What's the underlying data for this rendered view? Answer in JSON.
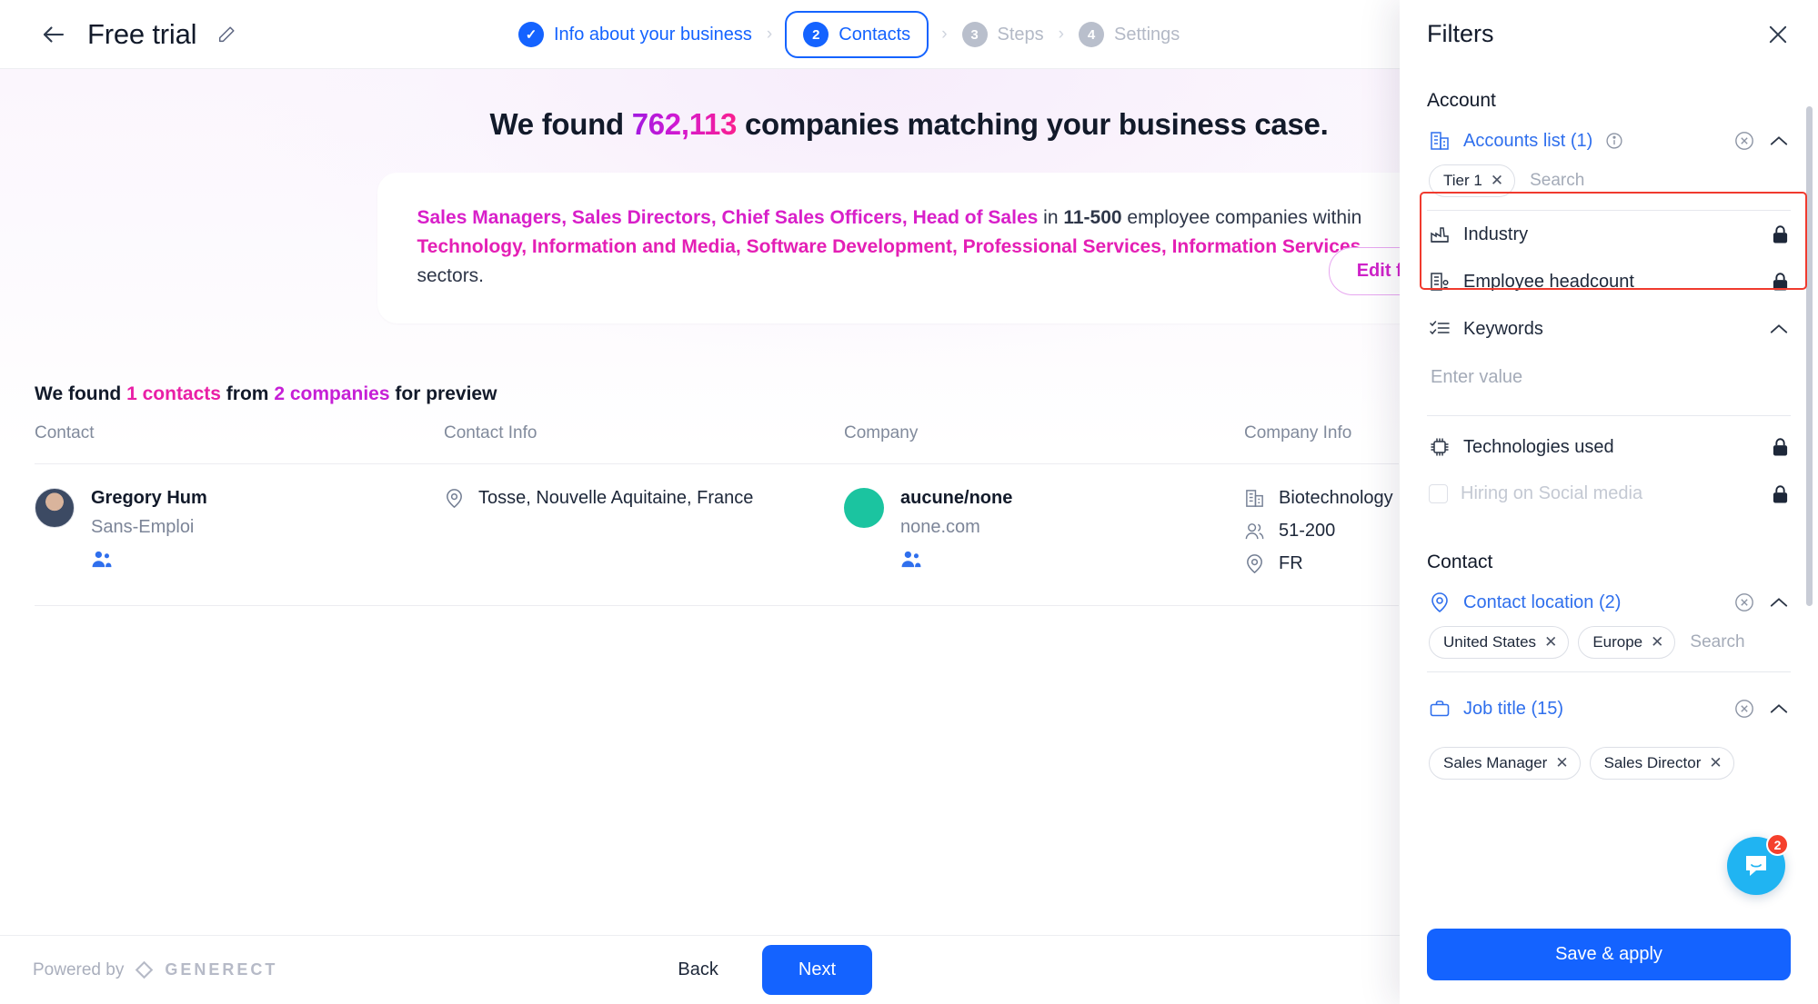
{
  "topbar": {
    "back_icon": "arrow-left-icon",
    "title": "Free trial",
    "edit_icon": "pencil-icon",
    "steps": [
      {
        "badge": "✓",
        "label": "Info about your business",
        "state": "done"
      },
      {
        "badge": "2",
        "label": "Contacts",
        "state": "active"
      },
      {
        "badge": "3",
        "label": "Steps",
        "state": "todo"
      },
      {
        "badge": "4",
        "label": "Settings",
        "state": "todo"
      }
    ],
    "separator": "›"
  },
  "main": {
    "headline_prefix": "We found ",
    "headline_count": "762,113",
    "headline_suffix": " companies matching your business case.",
    "summary": {
      "titles": "Sales Managers, Sales Directors, Chief Sales Officers, Head of Sales",
      "in_word": " in ",
      "headcount": "11-500",
      "employee_text": " employee companies within ",
      "industries": "Technology, Information and Media, Software Development, Professional Services, Information Services",
      "sectors_text": " sectors."
    },
    "edit_filters_label": "Edit filters",
    "preview": {
      "prefix": "We found ",
      "contacts": "1 contacts",
      "middle": " from ",
      "companies": "2 companies",
      "suffix": " for preview",
      "columns": [
        "Contact",
        "Contact Info",
        "Company",
        "Company Info"
      ],
      "rows": [
        {
          "contact_name": "Gregory Hum",
          "contact_role": "Sans-Emploi",
          "contact_social_icon": "linkedin-people-icon",
          "contact_location": "Tosse, Nouvelle Aquitaine, France",
          "contact_location_icon": "map-pin-icon",
          "company_name": "aucune/none",
          "company_domain": "none.com",
          "company_social_icon": "linkedin-people-icon",
          "company_industry": "Biotechnology",
          "company_industry_icon": "building-icon",
          "company_headcount": "51-200",
          "company_headcount_icon": "people-icon",
          "company_country": "FR",
          "company_country_icon": "map-pin-icon"
        }
      ]
    }
  },
  "footer": {
    "powered_by": "Powered by",
    "brand": "GENERECT",
    "brand_icon": "diamond-logo-icon",
    "back_label": "Back",
    "next_label": "Next"
  },
  "filters": {
    "title": "Filters",
    "close_icon": "close-icon",
    "account_section": "Account",
    "contact_section": "Contact",
    "save_apply_label": "Save & apply",
    "groups": [
      {
        "id": "accounts-list",
        "icon": "building-list-icon",
        "label": "Accounts list (1)",
        "state": "active",
        "has_info": true,
        "has_clear": true,
        "chevron": "chevron-up-icon",
        "chips": [
          "Tier 1"
        ],
        "search_placeholder": "Search"
      },
      {
        "id": "industry",
        "icon": "factory-icon",
        "label": "Industry",
        "state": "locked",
        "lock_icon": "lock-icon"
      },
      {
        "id": "employee-headcount",
        "icon": "building-person-icon",
        "label": "Employee headcount",
        "state": "locked",
        "lock_icon": "lock-icon"
      },
      {
        "id": "keywords",
        "icon": "checklist-icon",
        "label": "Keywords",
        "state": "open",
        "chevron": "chevron-up-icon",
        "value_placeholder": "Enter value"
      },
      {
        "id": "technologies-used",
        "icon": "chip-icon",
        "label": "Technologies used",
        "state": "locked",
        "lock_icon": "lock-icon"
      },
      {
        "id": "hiring-on-social-media",
        "icon": "checkbox-icon",
        "label": "Hiring on Social media",
        "state": "locked-disabled",
        "lock_icon": "lock-icon"
      },
      {
        "id": "contact-location",
        "icon": "map-pin-icon",
        "label": "Contact location (2)",
        "state": "active",
        "has_clear": true,
        "chevron": "chevron-up-icon",
        "chips": [
          "United States",
          "Europe"
        ],
        "search_placeholder": "Search"
      },
      {
        "id": "job-title",
        "icon": "briefcase-icon",
        "label": "Job title (15)",
        "state": "active",
        "has_clear": true,
        "chevron": "chevron-up-icon",
        "chips": [
          "Sales Manager",
          "Sales Director"
        ]
      }
    ]
  },
  "intercom": {
    "icon": "chat-bubble-icon",
    "badge": "2"
  },
  "colors": {
    "accent_blue": "#1463ff",
    "magenta": "#d81fc9",
    "pink": "#fa1f8e",
    "highlight_red": "#f03a2e",
    "intercom_blue": "#20b4f2",
    "avatar_green": "#1bc4a0"
  }
}
